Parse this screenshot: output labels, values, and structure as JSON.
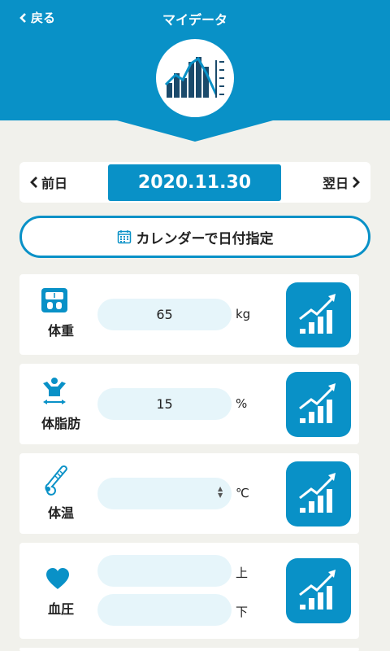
{
  "header": {
    "back_label": "戻る",
    "title": "マイデータ",
    "brand_color": "#0991c7"
  },
  "date_nav": {
    "prev_label": "前日",
    "next_label": "翌日",
    "current_date": "2020.11.30"
  },
  "calendar_button": {
    "label": "カレンダーで日付指定",
    "icon": "calendar-icon"
  },
  "metrics": {
    "weight": {
      "label": "体重",
      "value": "65",
      "unit": "kg",
      "icon": "scale-icon"
    },
    "body_fat": {
      "label": "体脂肪",
      "value": "15",
      "unit": "%",
      "icon": "body-fat-icon"
    },
    "temperature": {
      "label": "体温",
      "value": "",
      "unit": "℃",
      "icon": "thermometer-icon"
    },
    "blood_pressure": {
      "label": "血圧",
      "upper_value": "",
      "lower_value": "",
      "upper_unit": "上",
      "lower_unit": "下",
      "icon": "heart-icon"
    }
  }
}
